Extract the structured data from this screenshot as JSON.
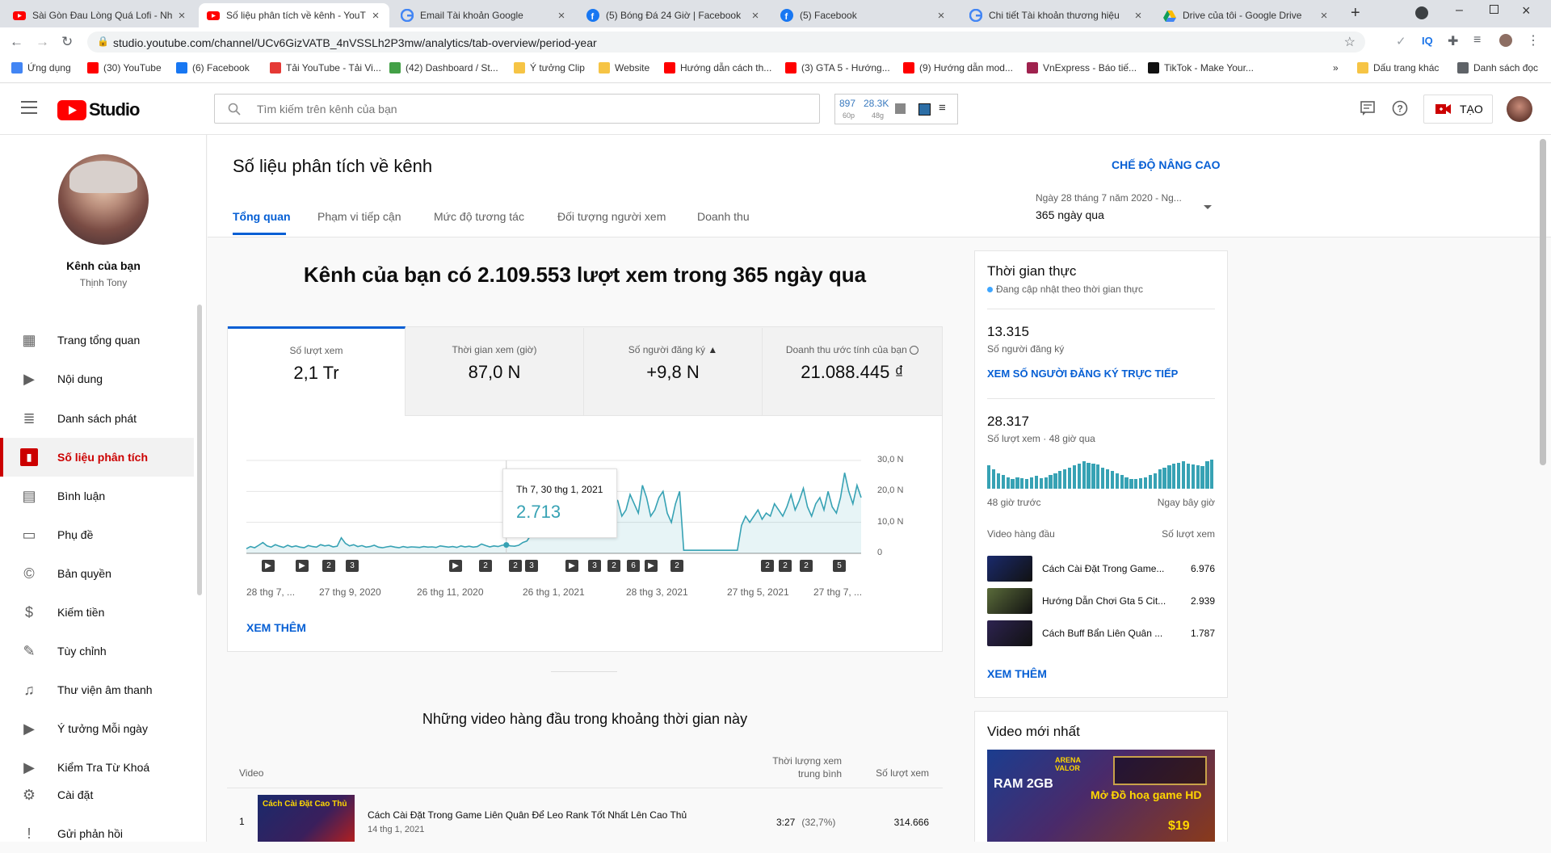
{
  "browser": {
    "tabs": [
      {
        "title": "Sài Gòn Đau Lòng Quá Lofi - Nh",
        "icon": "youtube-icon",
        "color": "#ff0000"
      },
      {
        "title": "Số liệu phân tích về kênh - YouT",
        "icon": "youtube-icon",
        "color": "#ff0000"
      },
      {
        "title": "Email Tài khoản Google",
        "icon": "google-icon",
        "color": "#4285f4"
      },
      {
        "title": "(5) Bóng Đá 24 Giờ | Facebook",
        "icon": "facebook-icon",
        "color": "#1877f2"
      },
      {
        "title": "(5) Facebook",
        "icon": "facebook-icon",
        "color": "#1877f2"
      },
      {
        "title": "Chi tiết Tài khoản thương hiệu",
        "icon": "google-icon",
        "color": "#4285f4"
      },
      {
        "title": "Drive của tôi - Google Drive",
        "icon": "drive-icon",
        "color": "#0f9d58"
      }
    ],
    "url": "studio.youtube.com/channel/UCv6GizVATB_4nVSSLh2P3mw/analytics/tab-overview/period-year",
    "bookmarks": [
      {
        "label": "Ứng dụng",
        "color": "#4285f4"
      },
      {
        "label": "(30) YouTube",
        "color": "#ff0000"
      },
      {
        "label": "(6) Facebook",
        "color": "#1877f2"
      },
      {
        "label": "Tải YouTube - Tải Vi...",
        "color": "#e53935"
      },
      {
        "label": "(42) Dashboard / St...",
        "color": "#43a047"
      },
      {
        "label": "Ý tưởng Clip",
        "color": "#f6c445"
      },
      {
        "label": "Website",
        "color": "#f6c445"
      },
      {
        "label": "Hướng dẫn cách th...",
        "color": "#ff0000"
      },
      {
        "label": "(3) GTA 5 - Hướng...",
        "color": "#ff0000"
      },
      {
        "label": "(9) Hướng dẫn mod...",
        "color": "#ff0000"
      },
      {
        "label": "VnExpress - Báo tiế...",
        "color": "#9f224e"
      },
      {
        "label": "TikTok - Make Your...",
        "color": "#111111"
      },
      {
        "label": "»",
        "color": ""
      },
      {
        "label": "Dấu trang khác",
        "color": "#f6c445"
      },
      {
        "label": "Danh sách đọc",
        "color": "#5f6368"
      }
    ]
  },
  "header": {
    "logo_text": "Studio",
    "search_placeholder": "Tìm kiếm trên kênh của bạn",
    "ext": {
      "a": "897",
      "a_sub": "60p",
      "b": "28.3K",
      "b_sub": "48g"
    },
    "create_label": "TẠO"
  },
  "sidebar": {
    "channel_label": "Kênh của bạn",
    "channel_name": "Thịnh Tony",
    "items": [
      {
        "label": "Trang tổng quan",
        "icon": "dashboard-icon"
      },
      {
        "label": "Nội dung",
        "icon": "content-icon"
      },
      {
        "label": "Danh sách phát",
        "icon": "playlist-icon"
      },
      {
        "label": "Số liệu phân tích",
        "icon": "analytics-icon"
      },
      {
        "label": "Bình luận",
        "icon": "comments-icon"
      },
      {
        "label": "Phụ đề",
        "icon": "subtitles-icon"
      },
      {
        "label": "Bản quyền",
        "icon": "copyright-icon"
      },
      {
        "label": "Kiếm tiền",
        "icon": "dollar-icon"
      },
      {
        "label": "Tùy chỉnh",
        "icon": "wand-icon"
      },
      {
        "label": "Thư viện âm thanh",
        "icon": "audio-library-icon"
      },
      {
        "label": "Ý tưởng Mỗi ngày",
        "icon": "ideas-icon"
      },
      {
        "label": "Kiểm Tra Từ Khoá",
        "icon": "keyword-icon"
      },
      {
        "label": "Cài đặt",
        "icon": "gear-icon"
      },
      {
        "label": "Gửi phản hồi",
        "icon": "feedback-icon"
      }
    ]
  },
  "page": {
    "title": "Số liệu phân tích về kênh",
    "advanced": "CHẾ ĐỘ NÂNG CAO",
    "tabs": [
      "Tổng quan",
      "Phạm vi tiếp cận",
      "Mức độ tương tác",
      "Đối tượng người xem",
      "Doanh thu"
    ],
    "date_range_label": "Ngày 28 tháng 7 năm 2020 - Ng...",
    "date_range_value": "365 ngày qua"
  },
  "overview": {
    "headline": "Kênh của bạn có 2.109.553 lượt xem trong 365 ngày qua",
    "metrics": [
      {
        "label": "Số lượt xem",
        "value": "2,1 Tr"
      },
      {
        "label": "Thời gian xem (giờ)",
        "value": "87,0 N"
      },
      {
        "label": "Số người đăng ký",
        "value": "+9,8 N"
      },
      {
        "label": "Doanh thu ước tính của bạn",
        "value": "21.088.445 ₫"
      }
    ],
    "tooltip": {
      "date": "Th 7, 30 thg 1, 2021",
      "value": "2.713"
    },
    "see_more": "XEM THÊM",
    "markers": [
      "▶",
      "▶",
      "2",
      "3",
      "▶",
      "2",
      "2",
      "3",
      "▶",
      "3",
      "2",
      "6",
      "▶",
      "2",
      "2",
      "2",
      "2",
      "5"
    ]
  },
  "chart_data": {
    "type": "line",
    "x_ticks": [
      "28 thg 7, ...",
      "27 thg 9, 2020",
      "26 thg 11, 2020",
      "26 thg 1, 2021",
      "28 thg 3, 2021",
      "27 thg 5, 2021",
      "27 thg 7, ..."
    ],
    "y_ticks": [
      "30,0 N",
      "20,0 N",
      "10,0 N",
      "0"
    ],
    "ylim": [
      0,
      30000
    ],
    "color": "#37a2b4",
    "series": [
      {
        "values": [
          1500,
          2200,
          1800,
          2600,
          3500,
          2400,
          2000,
          2800,
          2300,
          1900,
          2600,
          2100,
          2400,
          2000,
          1800,
          2500,
          2200,
          2000,
          2800,
          2400,
          2600,
          2100,
          2300,
          5000,
          3200,
          2400,
          2800,
          2200,
          2500,
          2000,
          2200,
          2600,
          2000,
          1800,
          2100,
          2300,
          2000,
          1800,
          2200,
          1900,
          2100,
          2000,
          1900,
          2200,
          2000,
          2100,
          1900,
          2400,
          2200,
          2000,
          2200,
          1900,
          2400,
          2100,
          2300,
          2000,
          2200,
          3000,
          2500,
          2100,
          2400,
          2200,
          2600,
          2713,
          2400,
          2300,
          2600,
          3500,
          4000,
          6000,
          8000,
          9000,
          10000,
          8000,
          9000,
          11000,
          13000,
          16000,
          12000,
          10000,
          15000,
          20000,
          14000,
          10000,
          16000,
          24000,
          15000,
          11000,
          13000,
          18000,
          17000,
          12000,
          14000,
          19000,
          16000,
          13000,
          22000,
          18000,
          12000,
          14000,
          18000,
          20000,
          13000,
          10000,
          16000,
          20000,
          1000,
          1000,
          1000,
          1000,
          1000,
          1000,
          1000,
          1000,
          1000,
          1000,
          1000,
          1000,
          1000,
          1000,
          9000,
          12000,
          10000,
          12000,
          14000,
          11000,
          13000,
          12000,
          16000,
          14000,
          12000,
          15000,
          19000,
          14000,
          17000,
          21000,
          15000,
          12000,
          16000,
          18000,
          14000,
          20000,
          15000,
          13000,
          18000,
          26000,
          20000,
          16000,
          22000,
          18000
        ]
      }
    ]
  },
  "top_videos": {
    "title": "Những video hàng đầu trong khoảng thời gian này",
    "col_video": "Video",
    "col_avg": "Thời lượng xem trung bình",
    "col_views": "Số lượt xem",
    "rows": [
      {
        "rank": "1",
        "title": "Cách Cài Đặt Trong Game Liên Quân Để Leo Rank Tốt Nhất Lên Cao Thủ",
        "date": "14 thg 1, 2021",
        "avg": "3:27",
        "pct": "(32,7%)",
        "views": "314.666"
      }
    ]
  },
  "realtime": {
    "title": "Thời gian thực",
    "subtitle": "Đang cập nhật theo thời gian thực",
    "subs": "13.315",
    "subs_label": "Số người đăng ký",
    "subs_link": "XEM SỐ NGƯỜI ĐĂNG KÝ TRỰC TIẾP",
    "views": "28.317",
    "views_label": "Số lượt xem · 48 giờ qua",
    "start_label": "48 giờ trước",
    "end_label": "Ngay bây giờ",
    "top_label": "Video hàng đầu",
    "views_col": "Số lượt xem",
    "bars": [
      24,
      20,
      16,
      14,
      12,
      10,
      12,
      11,
      10,
      12,
      13,
      11,
      12,
      14,
      16,
      18,
      20,
      22,
      24,
      26,
      28,
      27,
      26,
      25,
      22,
      20,
      18,
      16,
      14,
      12,
      10,
      10,
      11,
      12,
      14,
      16,
      20,
      22,
      24,
      26,
      27,
      28,
      26,
      25,
      24,
      23,
      28,
      30
    ],
    "videos": [
      {
        "title": "Cách Cài Đặt Trong Game...",
        "views": "6.976",
        "thumb": "#1a2a6c"
      },
      {
        "title": "Hướng Dẫn Chơi Gta 5 Cit...",
        "views": "2.939",
        "thumb": "#5a6b3a"
      },
      {
        "title": "Cách Buff Bẩn Liên Quân ...",
        "views": "1.787",
        "thumb": "#2d2350"
      }
    ],
    "see_more": "XEM THÊM"
  },
  "latest": {
    "title": "Video mới nhất",
    "thumb_text_1": "RAM 2GB",
    "thumb_text_2": "Mở Đồ hoạ game HD",
    "thumb_text_3": "$19",
    "thumb_text_4": "ARENA VALOR"
  }
}
